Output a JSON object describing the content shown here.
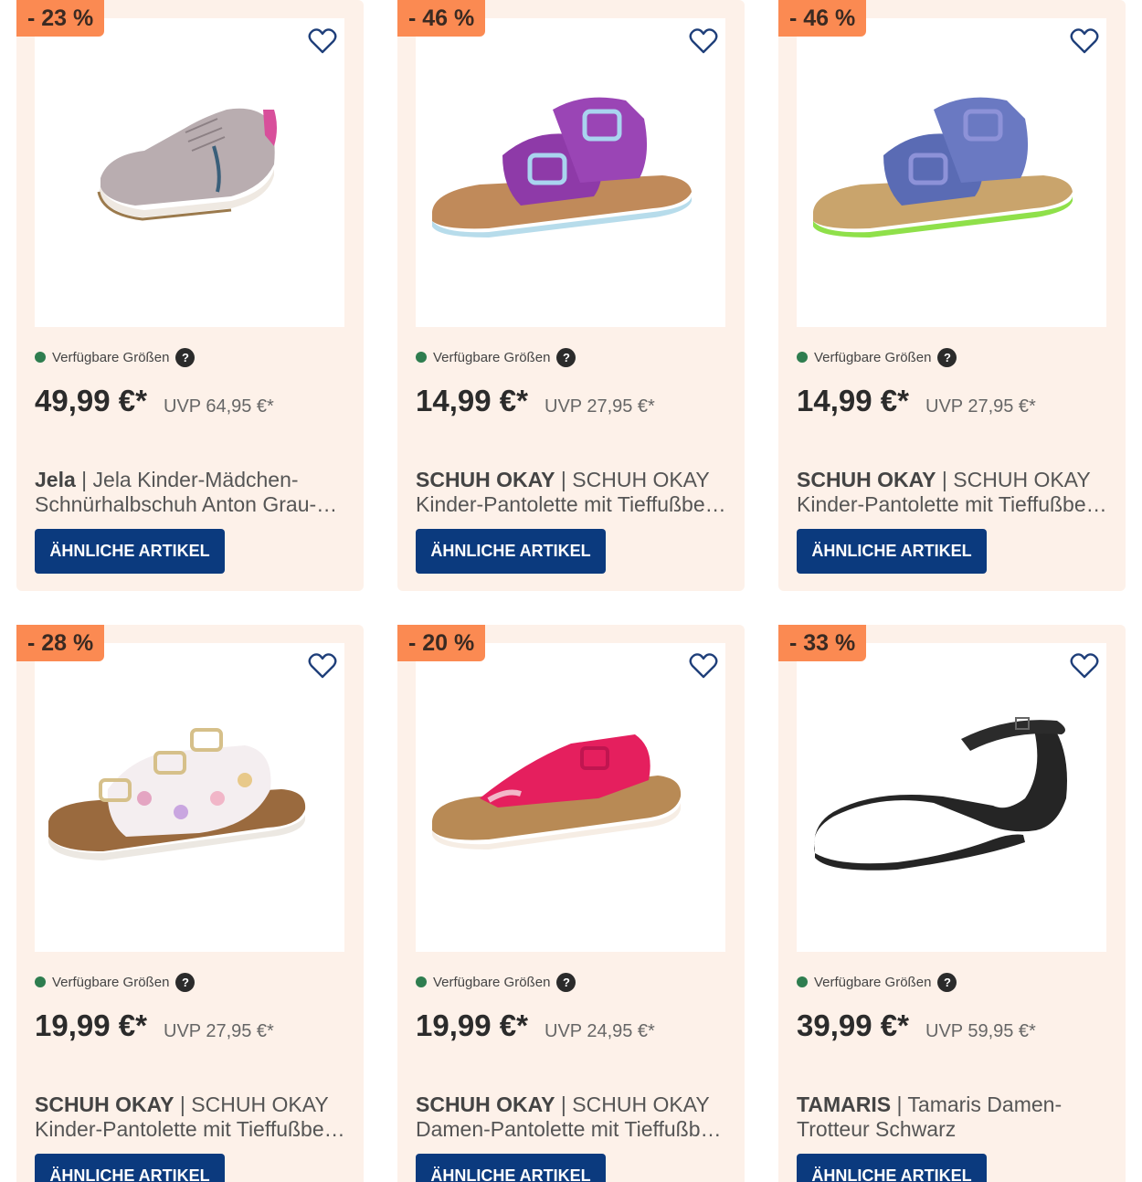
{
  "availability_label": "Verfügbare Größen",
  "help_icon_glyph": "?",
  "colors": {
    "card_bg": "#fdf1e9",
    "badge_bg": "#fb8a52",
    "button_bg": "#0b3a7e",
    "availability_dot": "#2e7d4f"
  },
  "products": [
    {
      "discount": "- 23 %",
      "price": "49,99 €*",
      "uvp": "UVP 64,95 €*",
      "brand": "Jela",
      "separator": " | ",
      "name_line1": "Jela Kinder-Mädchen-",
      "name_line2": "Schnürhalbschuh Anton Grau-…",
      "button": "ÄHNLICHE ARTIKEL",
      "icon": "heart-icon",
      "image": "grey-sneaker"
    },
    {
      "discount": "- 46 %",
      "price": "14,99 €*",
      "uvp": "UVP 27,95 €*",
      "brand": "SCHUH OKAY",
      "separator": " | ",
      "name_line1": "SCHUH OKAY",
      "name_line2": "Kinder-Pantolette mit Tieffußbet…",
      "button": "ÄHNLICHE ARTIKEL",
      "icon": "heart-icon",
      "image": "purple-sandal"
    },
    {
      "discount": "- 46 %",
      "price": "14,99 €*",
      "uvp": "UVP 27,95 €*",
      "brand": "SCHUH OKAY",
      "separator": " | ",
      "name_line1": "SCHUH OKAY",
      "name_line2": "Kinder-Pantolette mit Tieffußbet…",
      "button": "ÄHNLICHE ARTIKEL",
      "icon": "heart-icon",
      "image": "blue-sandal"
    },
    {
      "discount": "- 28 %",
      "price": "19,99 €*",
      "uvp": "UVP 27,95 €*",
      "brand": "SCHUH OKAY",
      "separator": " | ",
      "name_line1": "SCHUH OKAY",
      "name_line2": "Kinder-Pantolette mit Tieffußbet…",
      "button": "ÄHNLICHE ARTIKEL",
      "icon": "heart-icon",
      "image": "cupcake-sandal"
    },
    {
      "discount": "- 20 %",
      "price": "19,99 €*",
      "uvp": "UVP 24,95 €*",
      "brand": "SCHUH OKAY",
      "separator": " | ",
      "name_line1": "SCHUH OKAY",
      "name_line2": "Damen-Pantolette mit Tieffußbe…",
      "button": "ÄHNLICHE ARTIKEL",
      "icon": "heart-icon",
      "image": "pink-toe-post"
    },
    {
      "discount": "- 33 %",
      "price": "39,99 €*",
      "uvp": "UVP 59,95 €*",
      "brand": "TAMARIS",
      "separator": " | ",
      "name_line1": "Tamaris Damen-",
      "name_line2": "Trotteur Schwarz",
      "button": "ÄHNLICHE ARTIKEL",
      "icon": "heart-icon",
      "image": "black-flat"
    }
  ]
}
